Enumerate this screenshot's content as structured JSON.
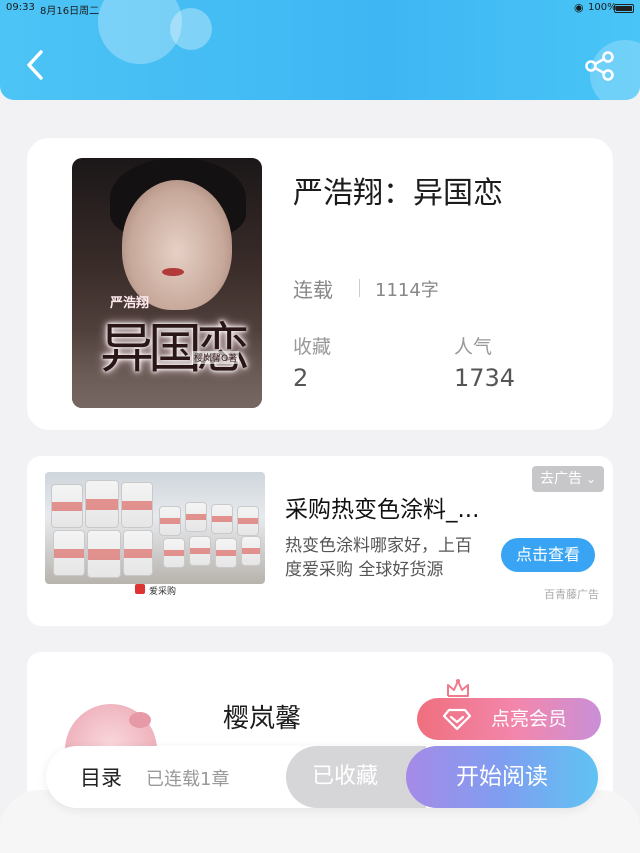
{
  "status_bar": {
    "time": "09:33",
    "date": "8月16日周二",
    "battery": "100%"
  },
  "header": {
    "back_icon": "chevron-left-icon",
    "share_icon": "share-icon",
    "color_start": "#4cc4f5",
    "color_end": "#3eb6f3"
  },
  "book": {
    "title": "严浩翔：异国恋",
    "status": "连载",
    "word_count": "1114字",
    "favorites_label": "收藏",
    "favorites_value": "2",
    "popularity_label": "人气",
    "popularity_value": "1734",
    "cover": {
      "small_text": "严浩翔",
      "title_text": "异国恋",
      "author_text": "樱岚馨O著"
    }
  },
  "ad": {
    "tag": "去广告",
    "title": "采购热变色涂料_...",
    "description": "热变色涂料哪家好，上百度爱采购 全球好货源",
    "button": "点击查看",
    "source": "百青藤广告",
    "logo_text": "爱采购",
    "button_color": "#3aa4f4"
  },
  "author": {
    "name": "樱岚馨",
    "vip_button": "点亮会员",
    "crown_icon": "crown-icon",
    "diamond_icon": "diamond-icon"
  },
  "bottom_bar": {
    "toc": "目录",
    "chapters": "已连载1章",
    "collected": "已收藏",
    "start_reading": "开始阅读"
  }
}
